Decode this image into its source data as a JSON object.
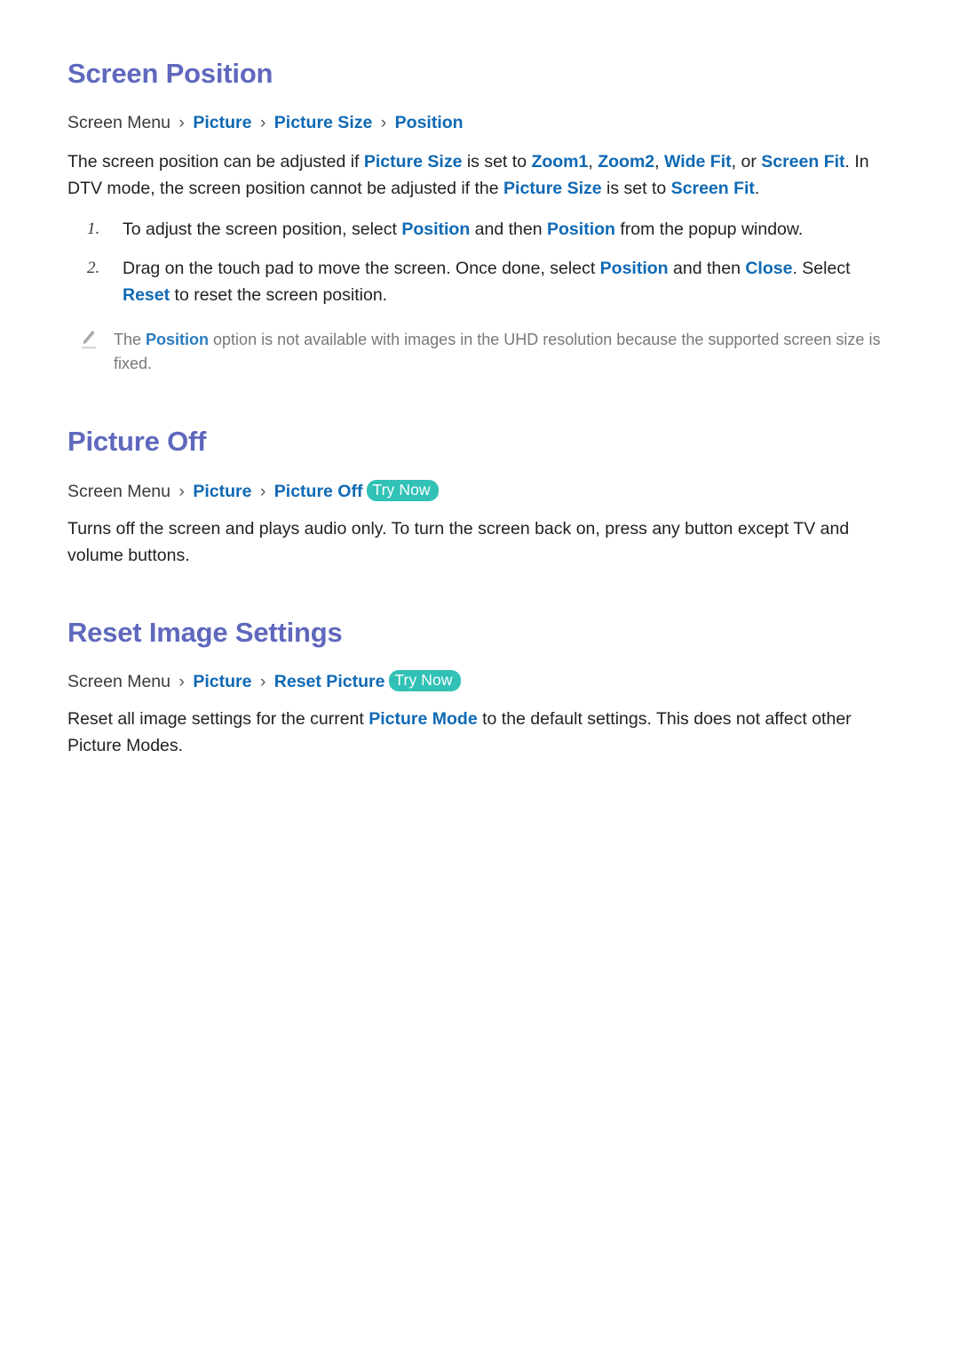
{
  "document": {
    "page_background": "#ffffff",
    "heading_color": "#5f68bd",
    "link_color": "#0f69b4",
    "badge_color": "#31c1b6",
    "note_color": "#77787b"
  },
  "sections": [
    {
      "id": "screen-position",
      "title": "Screen Position",
      "breadcrumb": {
        "root": "Screen Menu",
        "sep": "›",
        "links": [
          "Picture",
          "Picture Size",
          "Position"
        ],
        "try_now": null
      },
      "intro": {
        "parts": [
          {
            "t": "The screen position can be adjusted if ",
            "k": "plain"
          },
          {
            "t": "Picture Size",
            "k": "link"
          },
          {
            "t": " is set to ",
            "k": "plain"
          },
          {
            "t": "Zoom1",
            "k": "link"
          },
          {
            "t": ", ",
            "k": "plain"
          },
          {
            "t": "Zoom2",
            "k": "link"
          },
          {
            "t": ", ",
            "k": "plain"
          },
          {
            "t": "Wide Fit",
            "k": "link"
          },
          {
            "t": ", or ",
            "k": "plain"
          },
          {
            "t": "Screen Fit",
            "k": "link"
          },
          {
            "t": ". In DTV mode, the screen position cannot be adjusted if the ",
            "k": "plain"
          },
          {
            "t": "Picture Size",
            "k": "link"
          },
          {
            "t": " is set to ",
            "k": "plain"
          },
          {
            "t": "Screen Fit",
            "k": "link"
          },
          {
            "t": ".",
            "k": "plain"
          }
        ]
      },
      "steps": [
        {
          "marker": "1.",
          "parts": [
            {
              "t": "To adjust the screen position, select ",
              "k": "plain"
            },
            {
              "t": "Position",
              "k": "link"
            },
            {
              "t": " and then ",
              "k": "plain"
            },
            {
              "t": "Position",
              "k": "link"
            },
            {
              "t": " from the popup window.",
              "k": "plain"
            }
          ]
        },
        {
          "marker": "2.",
          "parts": [
            {
              "t": "Drag on the touch pad to move the screen. Once done, select ",
              "k": "plain"
            },
            {
              "t": "Position",
              "k": "link"
            },
            {
              "t": " and then ",
              "k": "plain"
            },
            {
              "t": "Close",
              "k": "link"
            },
            {
              "t": ". Select ",
              "k": "plain"
            },
            {
              "t": "Reset",
              "k": "link"
            },
            {
              "t": " to reset the screen position.",
              "k": "plain"
            }
          ]
        }
      ],
      "note": {
        "icon": "pencil-icon",
        "parts": [
          {
            "t": "The ",
            "k": "plain"
          },
          {
            "t": "Position",
            "k": "link"
          },
          {
            "t": " option is not available with images in the UHD resolution because the supported screen size is fixed.",
            "k": "plain"
          }
        ]
      }
    },
    {
      "id": "picture-off",
      "title": "Picture Off",
      "breadcrumb": {
        "root": "Screen Menu",
        "sep": "›",
        "links": [
          "Picture",
          "Picture Off"
        ],
        "try_now": "Try Now"
      },
      "intro": {
        "parts": [
          {
            "t": "Turns off the screen and plays audio only. To turn the screen back on, press any button except TV and volume buttons.",
            "k": "plain"
          }
        ]
      },
      "steps": [],
      "note": null
    },
    {
      "id": "reset-image-settings",
      "title": "Reset Image Settings",
      "breadcrumb": {
        "root": "Screen Menu",
        "sep": "›",
        "links": [
          "Picture",
          "Reset Picture"
        ],
        "try_now": "Try Now"
      },
      "intro": {
        "parts": [
          {
            "t": "Reset all image settings for the current ",
            "k": "plain"
          },
          {
            "t": "Picture Mode",
            "k": "link"
          },
          {
            "t": " to the default settings. This does not affect other Picture Modes.",
            "k": "plain"
          }
        ]
      },
      "steps": [],
      "note": null
    }
  ]
}
